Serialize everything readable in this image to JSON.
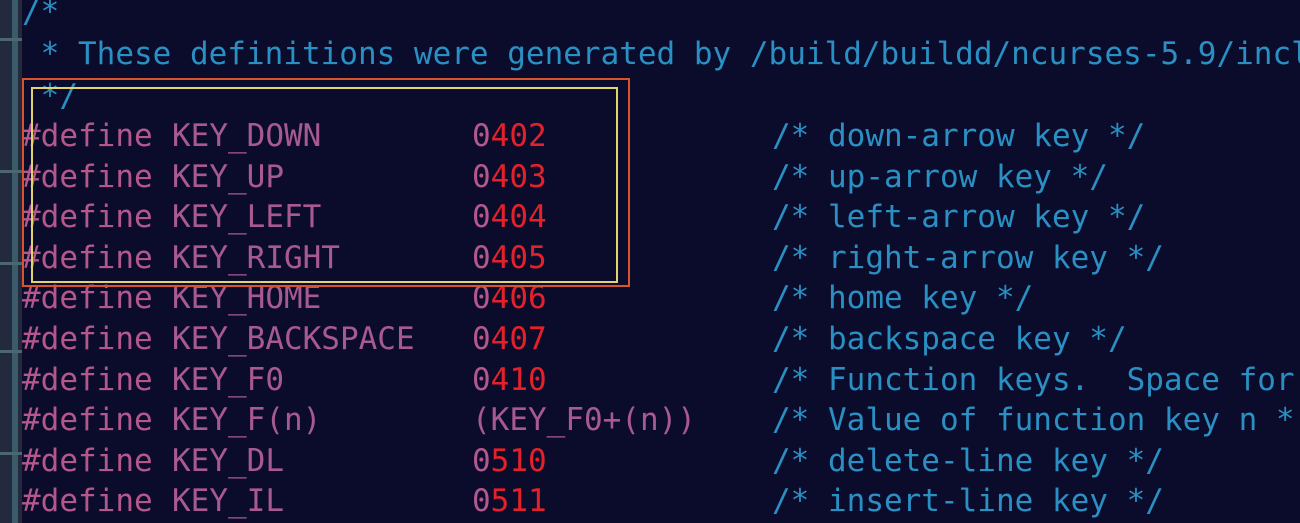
{
  "header_comment": {
    "open": "/*",
    "body": " * These definitions were generated by /build/buildd/ncurses-5.9/incl",
    "close": " */"
  },
  "defines": [
    {
      "keyword": "#define",
      "name": "KEY_DOWN",
      "value_prefix": "0",
      "value_rest": "402",
      "comment": "/* down-arrow key */"
    },
    {
      "keyword": "#define",
      "name": "KEY_UP",
      "value_prefix": "0",
      "value_rest": "403",
      "comment": "/* up-arrow key */"
    },
    {
      "keyword": "#define",
      "name": "KEY_LEFT",
      "value_prefix": "0",
      "value_rest": "404",
      "comment": "/* left-arrow key */"
    },
    {
      "keyword": "#define",
      "name": "KEY_RIGHT",
      "value_prefix": "0",
      "value_rest": "405",
      "comment": "/* right-arrow key */"
    },
    {
      "keyword": "#define",
      "name": "KEY_HOME",
      "value_prefix": "0",
      "value_rest": "406",
      "comment": "/* home key */"
    },
    {
      "keyword": "#define",
      "name": "KEY_BACKSPACE",
      "value_prefix": "0",
      "value_rest": "407",
      "comment": "/* backspace key */"
    },
    {
      "keyword": "#define",
      "name": "KEY_F0",
      "value_prefix": "0",
      "value_rest": "410",
      "comment": "/* Function keys.  Space for"
    },
    {
      "keyword": "#define",
      "name": "KEY_F(n)",
      "value_expr": "(KEY_F0+(n))",
      "comment": "/* Value of function key n *"
    },
    {
      "keyword": "#define",
      "name": "KEY_DL",
      "value_prefix": "0",
      "value_rest": "510",
      "comment": "/* delete-line key */"
    },
    {
      "keyword": "#define",
      "name": "KEY_IL",
      "value_prefix": "0",
      "value_rest": "511",
      "comment": "/* insert-line key */"
    }
  ],
  "colors": {
    "background": "#0b0c2c",
    "comment": "#2a8fc2",
    "directive": "#b4578b",
    "number": "#e4212a",
    "highlight_outer": "#d9532c",
    "highlight_inner": "#e2d36a"
  }
}
